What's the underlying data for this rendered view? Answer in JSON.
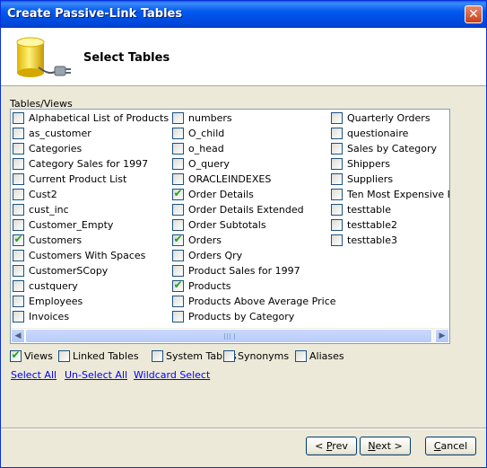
{
  "window": {
    "title": "Create Passive-Link Tables",
    "close_symbol": "✕"
  },
  "header": {
    "title": "Select Tables",
    "icon": "database-plug-icon"
  },
  "tables_label": "Tables/Views",
  "tables": [
    [
      {
        "label": "Alphabetical List of Products",
        "checked": false
      },
      {
        "label": "as_customer",
        "checked": false
      },
      {
        "label": "Categories",
        "checked": false
      },
      {
        "label": "Category Sales for 1997",
        "checked": false
      },
      {
        "label": "Current Product List",
        "checked": false
      },
      {
        "label": "Cust2",
        "checked": false
      },
      {
        "label": "cust_inc",
        "checked": false
      },
      {
        "label": "Customer_Empty",
        "checked": false
      },
      {
        "label": "Customers",
        "checked": true
      },
      {
        "label": "Customers With Spaces",
        "checked": false
      },
      {
        "label": "CustomerSCopy",
        "checked": false
      },
      {
        "label": "custquery",
        "checked": false
      },
      {
        "label": "Employees",
        "checked": false
      },
      {
        "label": "Invoices",
        "checked": false
      }
    ],
    [
      {
        "label": "numbers",
        "checked": false
      },
      {
        "label": "O_child",
        "checked": false
      },
      {
        "label": "o_head",
        "checked": false
      },
      {
        "label": "O_query",
        "checked": false
      },
      {
        "label": "ORACLEINDEXES",
        "checked": false
      },
      {
        "label": "Order Details",
        "checked": true
      },
      {
        "label": "Order Details Extended",
        "checked": false
      },
      {
        "label": "Order Subtotals",
        "checked": false
      },
      {
        "label": "Orders",
        "checked": true
      },
      {
        "label": "Orders Qry",
        "checked": false
      },
      {
        "label": "Product Sales for 1997",
        "checked": false
      },
      {
        "label": "Products",
        "checked": true
      },
      {
        "label": "Products Above Average Price",
        "checked": false
      },
      {
        "label": "Products by Category",
        "checked": false
      }
    ],
    [
      {
        "label": "Quarterly Orders",
        "checked": false
      },
      {
        "label": "questionaire",
        "checked": false
      },
      {
        "label": "Sales by Category",
        "checked": false
      },
      {
        "label": "Shippers",
        "checked": false
      },
      {
        "label": "Suppliers",
        "checked": false
      },
      {
        "label": "Ten Most Expensive Products",
        "checked": false
      },
      {
        "label": "testtable",
        "checked": false
      },
      {
        "label": "testtable2",
        "checked": false
      },
      {
        "label": "testtable3",
        "checked": false
      }
    ]
  ],
  "filters": [
    {
      "label": "Views",
      "checked": true
    },
    {
      "label": "Linked Tables",
      "checked": false
    },
    {
      "label": "System Tables",
      "checked": false
    },
    {
      "label": "Synonyms",
      "checked": false
    },
    {
      "label": "Aliases",
      "checked": false
    }
  ],
  "links": {
    "select_all": "Select All",
    "unselect_all": "Un-Select All",
    "wildcard": "Wildcard Select"
  },
  "scroll_arrows": {
    "left": "◀",
    "right": "▶"
  },
  "check_symbol": "✔",
  "buttons": {
    "prev_arrow": "< ",
    "prev_key": "P",
    "prev_rest": "rev",
    "next_key": "N",
    "next_rest": "ext >",
    "cancel_key": "C",
    "cancel_rest": "ancel"
  }
}
